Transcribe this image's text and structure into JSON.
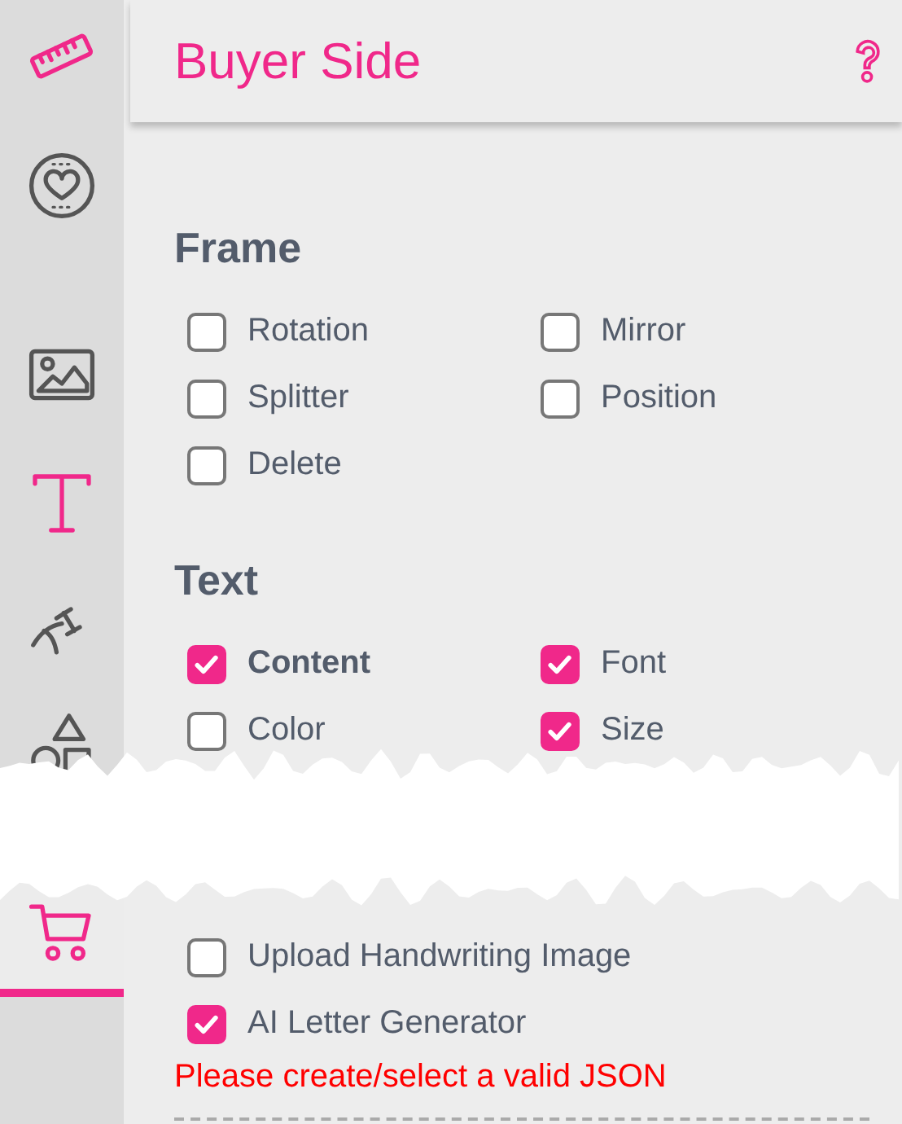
{
  "sidebar": {
    "items": [
      {
        "kind": "ruler",
        "highlighted": true,
        "selected": false
      },
      {
        "kind": "heart",
        "highlighted": false,
        "selected": false
      },
      {
        "kind": "image",
        "highlighted": false,
        "selected": false
      },
      {
        "kind": "text",
        "highlighted": true,
        "selected": false
      },
      {
        "kind": "curved-text",
        "highlighted": false,
        "selected": false
      },
      {
        "kind": "shapes",
        "highlighted": false,
        "selected": false
      },
      {
        "kind": "cart",
        "highlighted": true,
        "selected": true
      }
    ]
  },
  "header": {
    "title": "Buyer Side"
  },
  "sections": [
    {
      "heading": "Frame",
      "options": [
        {
          "label": "Rotation",
          "checked": false,
          "emphasized": false
        },
        {
          "label": "Mirror",
          "checked": false,
          "emphasized": false
        },
        {
          "label": "Splitter",
          "checked": false,
          "emphasized": false
        },
        {
          "label": "Position",
          "checked": false,
          "emphasized": false
        },
        {
          "label": "Delete",
          "checked": false,
          "emphasized": false
        }
      ]
    },
    {
      "heading": "Text",
      "options": [
        {
          "label": "Content",
          "checked": true,
          "emphasized": true
        },
        {
          "label": "Font",
          "checked": true,
          "emphasized": false
        },
        {
          "label": "Color",
          "checked": false,
          "emphasized": false
        },
        {
          "label": "Size",
          "checked": true,
          "emphasized": false
        }
      ]
    }
  ],
  "lower_options": [
    {
      "label": "Upload Handwriting Image",
      "checked": false,
      "emphasized": false
    },
    {
      "label": "AI Letter Generator",
      "checked": true,
      "emphasized": false
    }
  ],
  "error": "Please create/select a valid JSON"
}
